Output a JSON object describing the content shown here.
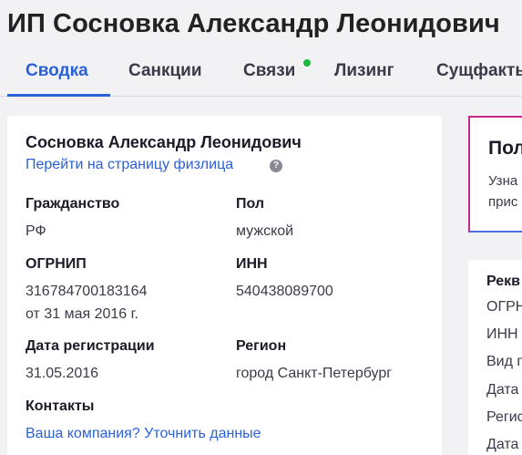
{
  "header": {
    "title": "ИП Сосновка Александр Леонидович",
    "tabs": [
      "Сводка",
      "Санкции",
      "Связи",
      "Лизинг",
      "Сущфакты"
    ]
  },
  "person": {
    "name": "Сосновка Александр Леонидович",
    "link": "Перейти на страницу физлица",
    "help": "?"
  },
  "fields": {
    "citizenship_label": "Гражданство",
    "citizenship_value": "РФ",
    "sex_label": "Пол",
    "sex_value": "мужской",
    "ogrnip_label": "ОГРНИП",
    "ogrnip_value": "316784700183164",
    "ogrnip_date": "от 31 мая 2016 г.",
    "inn_label": "ИНН",
    "inn_value": "540438089700",
    "regdate_label": "Дата регистрации",
    "regdate_value": "31.05.2016",
    "region_label": "Регион",
    "region_value": "город Санкт-Петербург",
    "contacts_label": "Контакты",
    "contacts_link": "Ваша компания? Уточнить данные"
  },
  "promo": {
    "title": "Пол",
    "line1": "Узна",
    "line2": "прис"
  },
  "requisites": {
    "title": "Рекв",
    "items": [
      "ОГРН",
      "ИНН",
      "Вид п",
      "Дата",
      "Регис",
      "Дата"
    ]
  },
  "colors": {
    "accent": "#2b61d8",
    "status_dot": "#1eb83a",
    "promo_border": "#c42a8c"
  }
}
